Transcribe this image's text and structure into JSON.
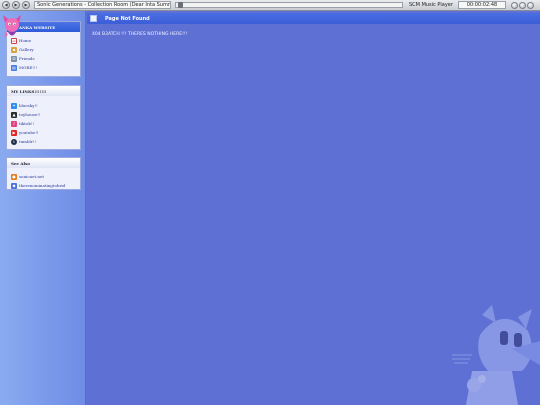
{
  "player": {
    "track_title": "Sonic Generations - Collection Room (Dear Inta Summer)",
    "player_name": "SCM Music Player",
    "time": "00:00:02:48",
    "progress_fraction": 0.01
  },
  "sidebar": {
    "site_box": {
      "title": "ANKA WEBSITE",
      "items": [
        {
          "label": "Home",
          "icon": "home-icon"
        },
        {
          "label": "Gallery",
          "icon": "gallery-icon"
        },
        {
          "label": "Friends",
          "icon": "friends-icon"
        },
        {
          "label": "MORE!!!",
          "icon": "more-icon"
        }
      ]
    },
    "links_box": {
      "title": "MY LINKS!!!!!!!",
      "items": [
        {
          "label": "bluesky!!",
          "icon": "bluesky-icon"
        },
        {
          "label": "toyhouse!!",
          "icon": "toyhouse-icon"
        },
        {
          "label": "tiktok!!",
          "icon": "tiktok-icon"
        },
        {
          "label": "youtube!!",
          "icon": "youtube-icon"
        },
        {
          "label": "tumblr!!",
          "icon": "tumblr-icon"
        }
      ]
    },
    "see_also_box": {
      "title": "See Also",
      "items": [
        {
          "label": "sonicnet.net",
          "icon": "sonicnet-icon"
        },
        {
          "label": "therenominatingtobrid",
          "icon": "link-icon"
        }
      ]
    }
  },
  "main": {
    "header": "Page Not Found",
    "message": "404 B3ATCH !!! THERES NOTHING HERE!!!"
  },
  "colors": {
    "background": "#5f70d4",
    "header_blue": "#3b5ed8",
    "link_color": "#2b3a9a"
  }
}
